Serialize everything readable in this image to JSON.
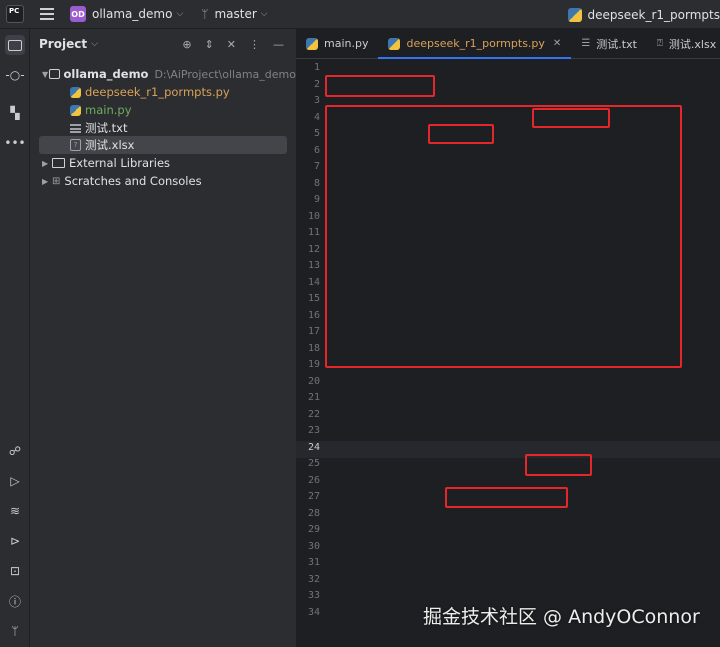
{
  "titlebar": {
    "logo_text": "PC",
    "project_badge": "OD",
    "project_name": "ollama_demo",
    "branch": "master",
    "run_config": "deepseek_r1_pormpts"
  },
  "project_panel": {
    "title": "Project",
    "tree": {
      "root_name": "ollama_demo",
      "root_path": "D:\\AiProject\\ollama_demo",
      "files": [
        "deepseek_r1_pormpts.py",
        "main.py",
        "测试.txt",
        "测试.xlsx"
      ],
      "external": "External Libraries",
      "scratches": "Scratches and Consoles"
    }
  },
  "tabs": [
    "main.py",
    "deepseek_r1_pormpts.py",
    "测试.txt",
    "测试.xlsx"
  ],
  "editor": {
    "line_numbers": [
      "1",
      "2",
      "3",
      "4",
      "5",
      "6",
      "7",
      "8",
      "9",
      "10",
      "11",
      "12",
      "13",
      "14",
      "15",
      "16",
      "17",
      "18",
      "19",
      "20",
      "21",
      "22",
      "23",
      "24",
      "25",
      "26",
      "27",
      "28",
      "29",
      "30",
      "31",
      "32",
      "33",
      "34"
    ],
    "current_line": "24"
  },
  "watermark": "掘金技术社区 @ AndyOConnor"
}
